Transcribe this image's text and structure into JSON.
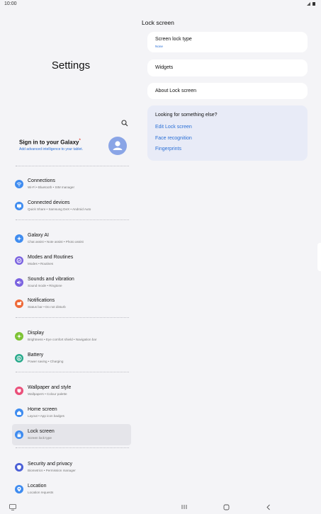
{
  "status": {
    "time": "10:00",
    "icons": "signal-icon battery-icon"
  },
  "left": {
    "title": "Settings",
    "signin": {
      "title": "Sign in to your Galaxy",
      "subtitle": "Add advanced intelligence to your tablet."
    },
    "items": [
      {
        "name": "connections",
        "title": "Connections",
        "sub": "Wi-Fi  •  Bluetooth  •  SIM manager",
        "color": "#3f8cf0",
        "icon": "wifi-icon"
      },
      {
        "name": "connected-devices",
        "title": "Connected devices",
        "sub": "Quick Share  •  Samsung DeX  •  Android Auto",
        "color": "#3f8cf0",
        "icon": "devices-icon"
      },
      {
        "name": "galaxy-ai",
        "title": "Galaxy AI",
        "sub": "Chat assist  •  Note assist  •  Photo assist",
        "color": "#3f8cf0",
        "icon": "sparkle-icon"
      },
      {
        "name": "modes-and-routines",
        "title": "Modes and Routines",
        "sub": "Modes  •  Routines",
        "color": "#7b63e0",
        "icon": "check-circle-icon"
      },
      {
        "name": "sounds-and-vibration",
        "title": "Sounds and vibration",
        "sub": "Sound mode  •  Ringtone",
        "color": "#7b63e0",
        "icon": "speaker-icon"
      },
      {
        "name": "notifications",
        "title": "Notifications",
        "sub": "Status bar  •  Do not disturb",
        "color": "#ee6a39",
        "icon": "bell-icon"
      },
      {
        "name": "display",
        "title": "Display",
        "sub": "Brightness  •  Eye comfort shield  •  Navigation bar",
        "color": "#7cc233",
        "icon": "sun-icon"
      },
      {
        "name": "battery",
        "title": "Battery",
        "sub": "Power saving  •  Charging",
        "color": "#27a98b",
        "icon": "battery-icon"
      },
      {
        "name": "wallpaper-and-style",
        "title": "Wallpaper and style",
        "sub": "Wallpapers  •  Colour palette",
        "color": "#ea4f7a",
        "icon": "palette-icon"
      },
      {
        "name": "home-screen",
        "title": "Home screen",
        "sub": "Layout  •  App icon badges",
        "color": "#3f8cf0",
        "icon": "home-icon"
      },
      {
        "name": "lock-screen",
        "title": "Lock screen",
        "sub": "Screen lock type",
        "color": "#3f8cf0",
        "icon": "lock-icon",
        "active": true
      },
      {
        "name": "security-and-privacy",
        "title": "Security and privacy",
        "sub": "Biometrics  •  Permission manager",
        "color": "#4a5fd6",
        "icon": "shield-icon"
      },
      {
        "name": "location",
        "title": "Location",
        "sub": "Location requests",
        "color": "#3f8cf0",
        "icon": "location-icon"
      }
    ]
  },
  "right": {
    "heading": "Lock screen",
    "screen_lock_type": {
      "label": "Screen lock type",
      "value": "None"
    },
    "widgets": "Widgets",
    "about": "About Lock screen",
    "suggest": {
      "head": "Looking for something else?",
      "links": [
        "Edit Lock screen",
        "Face recognition",
        "Fingerprints"
      ]
    }
  }
}
